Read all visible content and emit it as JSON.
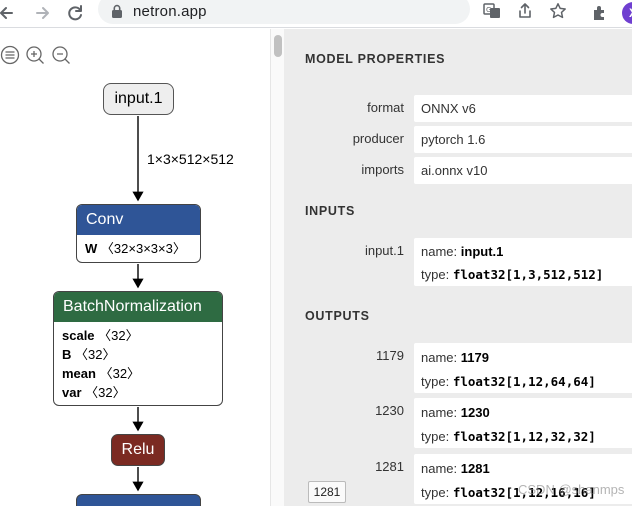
{
  "browser": {
    "url": "netron.app",
    "profile_initial": "X"
  },
  "graph": {
    "input_node": {
      "label": "input.1"
    },
    "input_edge_label": "1×3×512×512",
    "conv": {
      "label": "Conv",
      "attrs": [
        {
          "name": "W",
          "value": "〈32×3×3×3〉"
        }
      ]
    },
    "batchnorm": {
      "label": "BatchNormalization",
      "attrs": [
        {
          "name": "scale",
          "value": "〈32〉"
        },
        {
          "name": "B",
          "value": "〈32〉"
        },
        {
          "name": "mean",
          "value": "〈32〉"
        },
        {
          "name": "var",
          "value": "〈32〉"
        }
      ]
    },
    "relu": {
      "label": "Relu"
    },
    "colors": {
      "conv": "#2f5597",
      "batchnorm": "#2e6b42",
      "relu": "#7b2a22"
    }
  },
  "properties": {
    "model_title": "MODEL PROPERTIES",
    "model": [
      {
        "name": "format",
        "value": "ONNX v6"
      },
      {
        "name": "producer",
        "value": "pytorch 1.6"
      },
      {
        "name": "imports",
        "value": "ai.onnx v10"
      }
    ],
    "inputs_title": "INPUTS",
    "inputs": [
      {
        "name": "input.1",
        "label_name": "name:",
        "value_name": "input.1",
        "label_type": "type:",
        "value_type": "float32[1,3,512,512]"
      }
    ],
    "outputs_title": "OUTPUTS",
    "outputs": [
      {
        "name": "1179",
        "label_name": "name:",
        "value_name": "1179",
        "label_type": "type:",
        "value_type": "float32[1,12,64,64]"
      },
      {
        "name": "1230",
        "label_name": "name:",
        "value_name": "1230",
        "label_type": "type:",
        "value_type": "float32[1,12,32,32]"
      },
      {
        "name": "1281",
        "label_name": "name:",
        "value_name": "1281",
        "label_type": "type:",
        "value_type": "float32[1,12,16,16]"
      }
    ]
  },
  "tooltip": "1281",
  "watermark": "CSDN @shanmps"
}
